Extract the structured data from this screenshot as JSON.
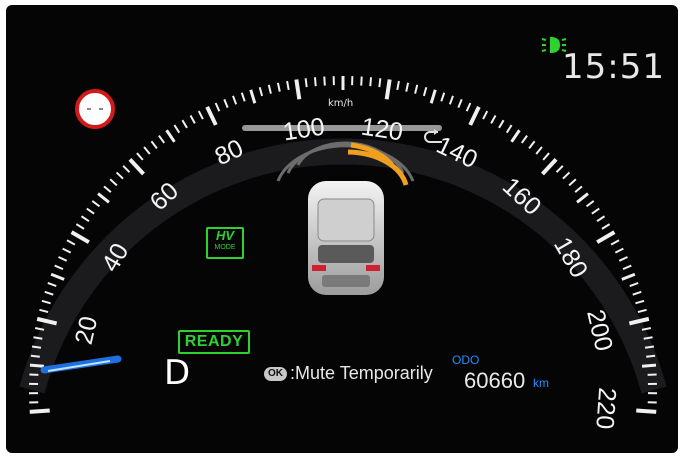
{
  "cluster": {
    "clock": "15:51",
    "speed_unit": "km/h",
    "speed_labels": [
      "20",
      "40",
      "60",
      "80",
      "100",
      "120",
      "140",
      "160",
      "180",
      "200",
      "220"
    ],
    "gear": "D",
    "ready_label": "READY",
    "hv_mode": {
      "top": "HV",
      "bottom": "MODE"
    },
    "mute": {
      "button": "OK",
      "text": ":Mute Temporarily"
    },
    "odometer": {
      "label": "ODO",
      "value": "60660",
      "unit": "km"
    },
    "icons": {
      "headlight": "headlight-indicator-icon",
      "speed_limit": "speed-limit-sign-icon",
      "return": "return-arrow-icon",
      "car": "vehicle-top-view-icon",
      "sensor": "parking-sensor-arcs-icon"
    },
    "colors": {
      "accent_green": "#2fd12f",
      "odo_blue": "#1e8fff",
      "sensor_amber": "#f0a020",
      "speed_needle_blue": "#1e6fe0"
    }
  }
}
